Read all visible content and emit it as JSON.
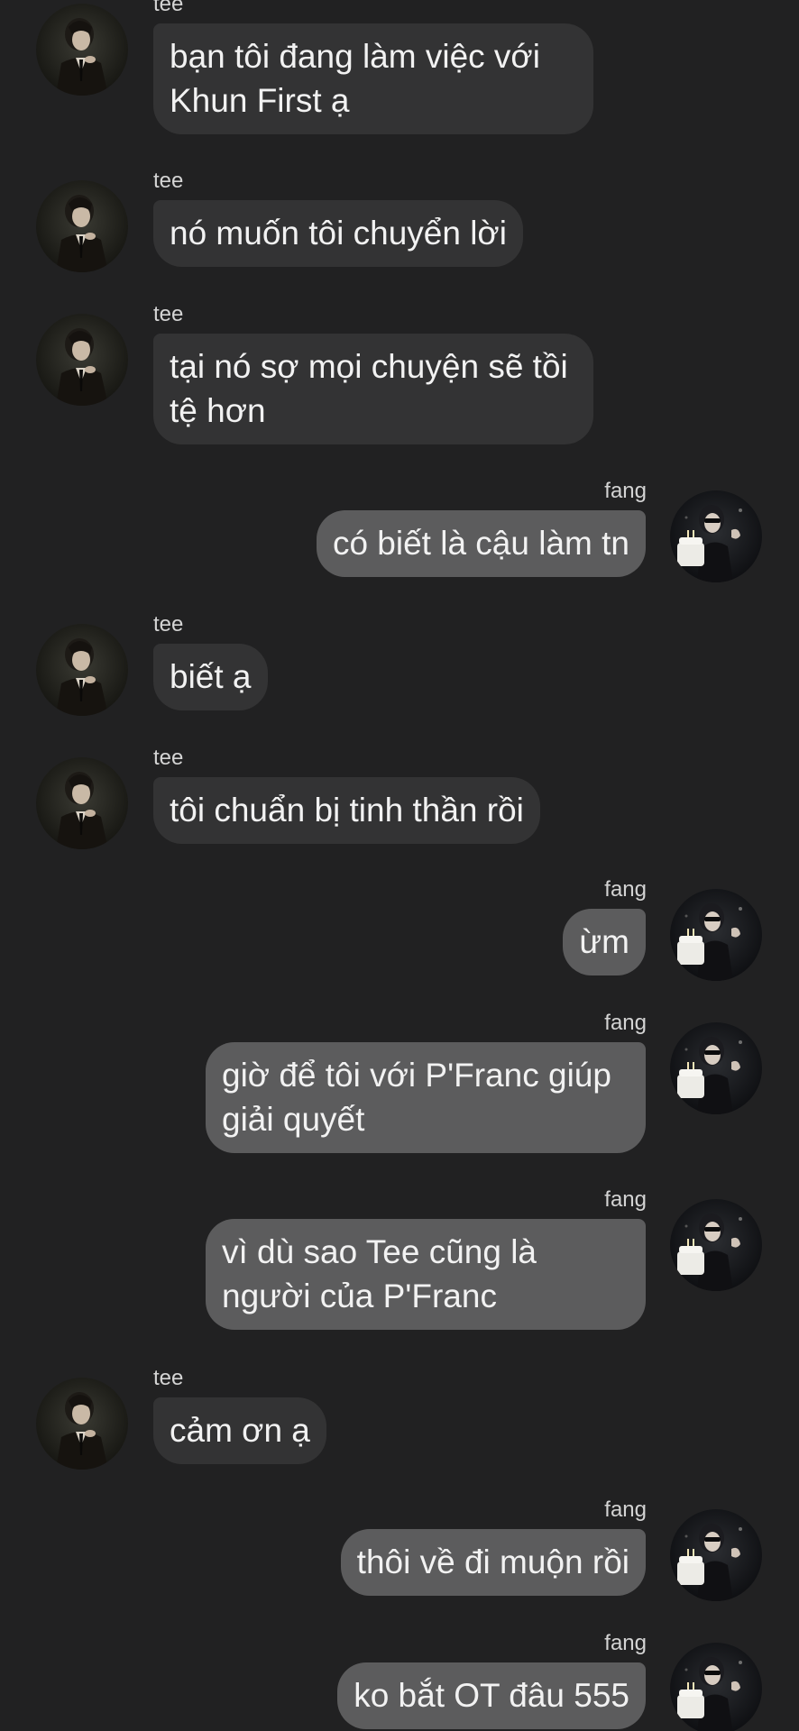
{
  "messages": [
    {
      "sender": "tee",
      "text": "bạn tôi đang làm việc với Khun First ạ"
    },
    {
      "sender": "tee",
      "text": "nó muốn tôi chuyển lời"
    },
    {
      "sender": "tee",
      "text": "tại nó sợ mọi chuyện sẽ tồi tệ hơn"
    },
    {
      "sender": "fang",
      "text": "có biết là cậu làm tn"
    },
    {
      "sender": "tee",
      "text": "biết ạ"
    },
    {
      "sender": "tee",
      "text": "tôi chuẩn bị tinh thần rồi"
    },
    {
      "sender": "fang",
      "text": "ừm"
    },
    {
      "sender": "fang",
      "text": "giờ để tôi với P'Franc giúp giải quyết"
    },
    {
      "sender": "fang",
      "text": "vì dù sao Tee cũng là người của P'Franc"
    },
    {
      "sender": "tee",
      "text": "cảm ơn ạ"
    },
    {
      "sender": "fang",
      "text": "thôi về đi muộn rồi"
    },
    {
      "sender": "fang",
      "text": "ko bắt OT đâu 555"
    }
  ],
  "colors": {
    "background": "#212122",
    "incoming_bubble": "#333334",
    "outgoing_bubble": "#5c5c5d",
    "text": "#f2f2f2",
    "name": "#d4d4d4"
  },
  "icons": {
    "incoming_avatar": "avatar-photo-tee",
    "outgoing_avatar": "avatar-photo-fang"
  }
}
